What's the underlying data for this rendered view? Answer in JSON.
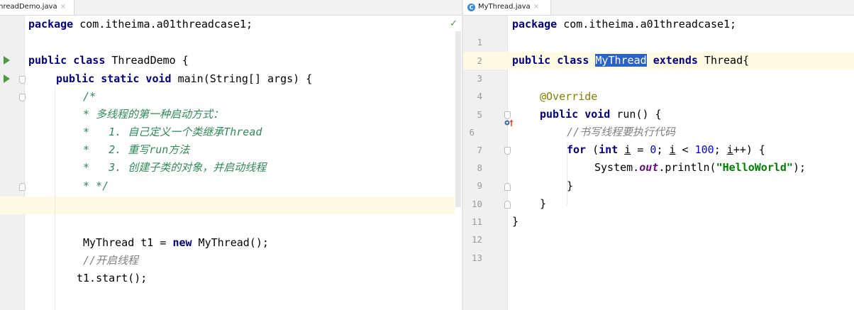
{
  "left_editor": {
    "tab": {
      "name": "ThreadDemo.java",
      "close": "×"
    },
    "status_check": "✓",
    "lines": [
      "package com.itheima.a01threadcase1;",
      "",
      "public class ThreadDemo {",
      "public static void main(String[] args) {",
      "/*",
      "* 多线程的第一种启动方式：",
      "*   1. 自己定义一个类继承Thread",
      "*   2. 重写run方法",
      "*   3. 创建子类的对象，并启动线程",
      "* */",
      "",
      "",
      "MyThread t1 = new MyThread();",
      "//开启线程",
      "t1.start();"
    ]
  },
  "right_editor": {
    "tab": {
      "name": "MyThread.java",
      "close": "×",
      "icon": "C"
    },
    "line_numbers": [
      "1",
      "2",
      "3",
      "4",
      "5",
      "6",
      "7",
      "8",
      "9",
      "10",
      "11",
      "12",
      "13"
    ],
    "lines": [
      "package com.itheima.a01threadcase1;",
      "",
      "public class MyThread extends Thread{",
      "",
      "@Override",
      "public void run() {",
      "//书写线程要执行代码",
      "for (int i = 0; i < 100; i++) {",
      "System.out.println(\"HelloWorld\");",
      "}",
      "}",
      "}",
      ""
    ]
  },
  "colors": {
    "keyword": "#000080",
    "doc_comment": "#2e8b57",
    "annotation": "#808000",
    "string": "#008000",
    "number": "#0000ff",
    "selection": "#2a62c6",
    "current_line": "#fefbe4"
  },
  "icons": [
    "run-gutter-icon",
    "fold-icon",
    "override-method-icon",
    "class-file-icon",
    "close-icon",
    "check-icon"
  ]
}
